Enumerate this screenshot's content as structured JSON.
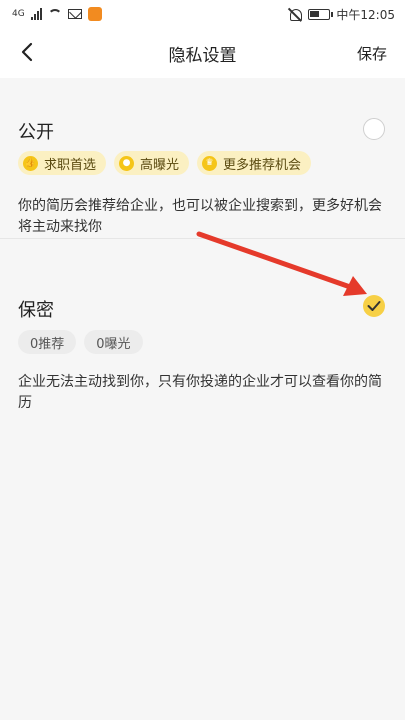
{
  "status_bar": {
    "time": "中午12:05",
    "signal_text": "4G"
  },
  "nav": {
    "title": "隐私设置",
    "save_label": "保存"
  },
  "public": {
    "title": "公开",
    "selected": false,
    "tags": [
      "求职首选",
      "高曝光",
      "更多推荐机会"
    ],
    "description": "你的简历会推荐给企业，也可以被企业搜索到，更多好机会将主动来找你"
  },
  "private": {
    "title": "保密",
    "selected": true,
    "tags": [
      "0推荐",
      "0曝光"
    ],
    "description": "企业无法主动找到你，只有你投递的企业才可以查看你的简历"
  },
  "colors": {
    "accent": "#f7d046",
    "arrow": "#e53a2b",
    "tag_bg": "#fbf0c2"
  }
}
